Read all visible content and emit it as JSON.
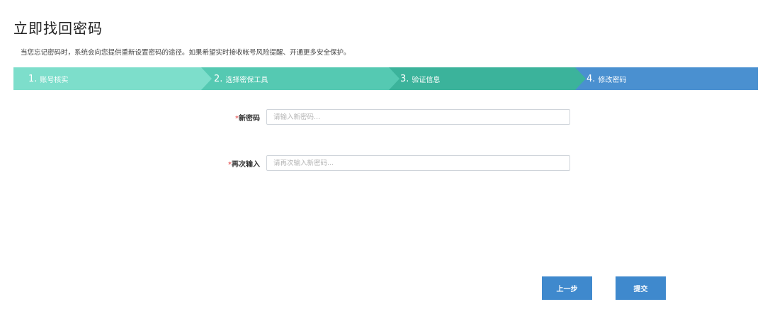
{
  "page": {
    "title": "立即找回密码",
    "subtitle": "当您忘记密码时，系统会向您提供重新设置密码的途径。如果希望实时接收帐号风险提醒、开通更多安全保护。"
  },
  "steps": [
    {
      "number": "1.",
      "label": "账号核实",
      "color": "#7ddecb"
    },
    {
      "number": "2.",
      "label": "选择密保工具",
      "color": "#55c9b2"
    },
    {
      "number": "3.",
      "label": "验证信息",
      "color": "#3bb39b"
    },
    {
      "number": "4.",
      "label": "修改密码",
      "color": "#4a90d0"
    }
  ],
  "form": {
    "required_mark": "*",
    "new_password": {
      "label": "新密码",
      "placeholder": "请输入新密码...",
      "value": ""
    },
    "confirm_password": {
      "label": "再次输入",
      "placeholder": "请再次输入新密码...",
      "value": ""
    }
  },
  "buttons": {
    "prev_label": "上一步",
    "submit_label": "提交",
    "color": "#3f89cd"
  }
}
